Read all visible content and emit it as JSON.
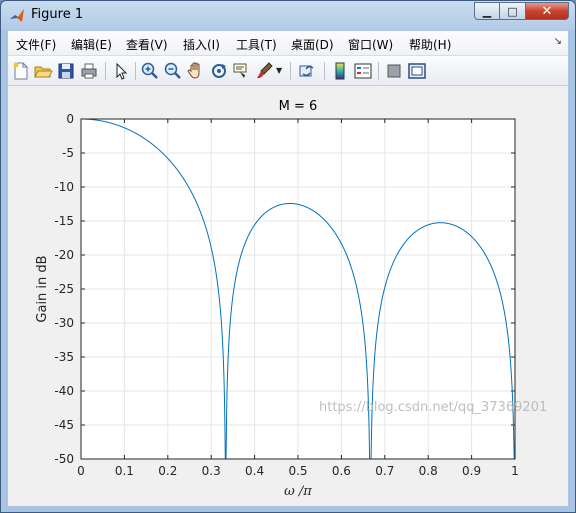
{
  "window": {
    "title": "Figure 1",
    "minimize_glyph": "▁",
    "maximize_glyph": "□",
    "close_glyph": "✕"
  },
  "menubar": {
    "items": [
      {
        "label": "文件(F)"
      },
      {
        "label": "编辑(E)"
      },
      {
        "label": "查看(V)"
      },
      {
        "label": "插入(I)"
      },
      {
        "label": "工具(T)"
      },
      {
        "label": "桌面(D)"
      },
      {
        "label": "窗口(W)"
      },
      {
        "label": "帮助(H)"
      }
    ],
    "overflow_glyph": "↘"
  },
  "toolbar": {
    "buttons": [
      {
        "name": "new-figure-icon"
      },
      {
        "name": "open-file-icon"
      },
      {
        "name": "save-icon"
      },
      {
        "name": "print-icon"
      },
      {
        "name": "edit-plot-arrow-icon"
      },
      {
        "name": "zoom-in-icon"
      },
      {
        "name": "zoom-out-icon"
      },
      {
        "name": "pan-hand-icon"
      },
      {
        "name": "rotate-3d-icon"
      },
      {
        "name": "data-cursor-icon"
      },
      {
        "name": "brush-icon"
      },
      {
        "name": "link-plot-icon"
      },
      {
        "name": "insert-colorbar-icon"
      },
      {
        "name": "insert-legend-icon"
      },
      {
        "name": "hide-plot-tools-icon"
      },
      {
        "name": "show-plot-tools-icon"
      }
    ]
  },
  "colors": {
    "line": "#0072bd",
    "axes_background": "#ffffff",
    "figure_background": "#f0f0f0",
    "grid": "#e6e6e6"
  },
  "watermark": "https://blog.csdn.net/qq_37369201",
  "chart_data": {
    "type": "line",
    "title": "M = 6",
    "xlabel": "ω /π",
    "ylabel": "Gain in dB",
    "xlim": [
      0,
      1
    ],
    "ylim": [
      -50,
      0
    ],
    "xticks": [
      "0",
      "0.1",
      "0.2",
      "0.3",
      "0.4",
      "0.5",
      "0.6",
      "0.7",
      "0.8",
      "0.9",
      "1"
    ],
    "yticks": [
      "0",
      "-5",
      "-10",
      "-15",
      "-20",
      "-25",
      "-30",
      "-35",
      "-40",
      "-45",
      "-50"
    ],
    "grid": true,
    "series": [
      {
        "formula": "20*log10(|sin(3*pi*x)/(6*sin(pi*x/2))|)",
        "x": [
          0,
          0.05,
          0.1,
          0.15,
          0.2,
          0.25,
          0.3,
          0.32,
          0.333,
          0.34,
          0.36,
          0.4,
          0.45,
          0.48,
          0.5,
          0.55,
          0.6,
          0.64,
          0.667,
          0.7,
          0.75,
          0.8,
          0.833,
          0.85,
          0.9,
          0.95,
          1.0
        ],
        "y": [
          0,
          -0.3,
          -1.3,
          -3.0,
          -5.9,
          -10.1,
          -17.6,
          -24.3,
          -50,
          -30.5,
          -20.7,
          -14.9,
          -12.7,
          -12.5,
          -12.6,
          -13.9,
          -17.1,
          -23.5,
          -50,
          -24.6,
          -17.8,
          -15.6,
          -15.3,
          -15.5,
          -18.6,
          -25.0,
          -50
        ]
      }
    ]
  }
}
